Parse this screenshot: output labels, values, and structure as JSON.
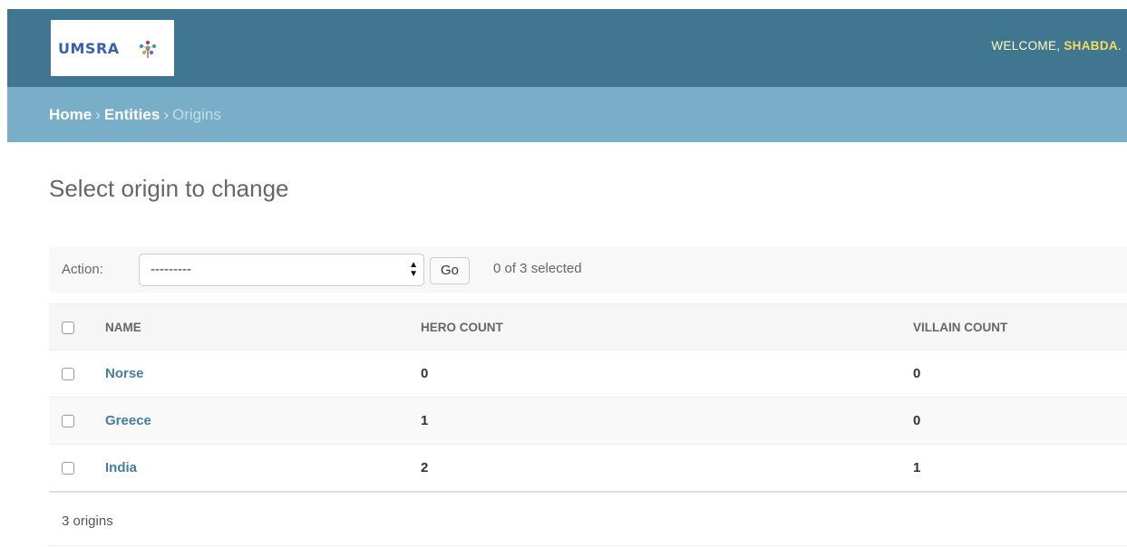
{
  "header": {
    "logo_text": "UMSRA",
    "welcome_prefix": "WELCOME,",
    "welcome_user": "SHABDA",
    "welcome_suffix": "."
  },
  "breadcrumbs": {
    "home": "Home",
    "entities": "Entities",
    "current": "Origins",
    "separator": "›"
  },
  "page": {
    "title": "Select origin to change"
  },
  "actions": {
    "label": "Action:",
    "select_value": "---------",
    "go_label": "Go",
    "selected_count": "0 of 3 selected"
  },
  "table": {
    "columns": [
      "NAME",
      "HERO COUNT",
      "VILLAIN COUNT"
    ],
    "rows": [
      {
        "name": "Norse",
        "hero_count": "0",
        "villain_count": "0"
      },
      {
        "name": "Greece",
        "hero_count": "1",
        "villain_count": "0"
      },
      {
        "name": "India",
        "hero_count": "2",
        "villain_count": "1"
      }
    ]
  },
  "paginator": {
    "text": "3 origins"
  },
  "colors": {
    "header_bg": "#417690",
    "breadcrumbs_bg": "#79aec8",
    "link": "#447e9b",
    "welcome_user": "#f5dd5d"
  }
}
